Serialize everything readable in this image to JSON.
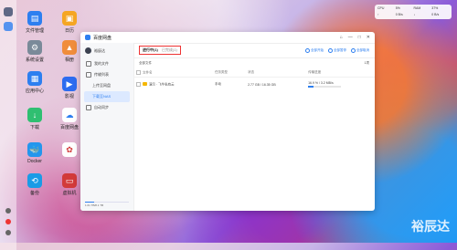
{
  "desktop": {
    "icons": [
      {
        "label": "文件管理",
        "color": "#2d7ff0",
        "icon": "folder-icon"
      },
      {
        "label": "系统设置",
        "color": "#7a8a99",
        "icon": "gear-icon"
      },
      {
        "label": "应用中心",
        "color": "#2d7ff0",
        "icon": "grid-icon"
      },
      {
        "label": "下载",
        "color": "#2fbf71",
        "icon": "download-icon"
      },
      {
        "label": "Docker",
        "color": "#2496ed",
        "icon": "docker-icon"
      },
      {
        "label": "备份",
        "color": "#1a9be6",
        "icon": "backup-icon"
      },
      {
        "label": "日历",
        "color": "#f5a623",
        "icon": "calendar-icon"
      },
      {
        "label": "相册",
        "color": "#f08d3c",
        "icon": "photo-icon"
      },
      {
        "label": "影视",
        "color": "#2d6cf0",
        "icon": "video-icon"
      },
      {
        "label": "百度网盘",
        "color": "#ffffff",
        "icon": "baidu-cloud-icon"
      },
      {
        "label": "",
        "color": "#ffffff",
        "icon": "app-icon"
      },
      {
        "label": "虚拟机",
        "color": "#d23a3a",
        "icon": "vm-icon"
      }
    ],
    "watermark": "裕辰达",
    "status": {
      "cells": [
        "CPU",
        "5%",
        "RAM",
        "37%",
        "↑",
        "0 B/s",
        "↓",
        "0 B/s"
      ]
    }
  },
  "window": {
    "title": "百度网盘",
    "controls": [
      "⌂",
      "—",
      "□",
      "✕"
    ]
  },
  "sidebar": {
    "username": "裕辰达",
    "items": [
      {
        "label": "我的文件",
        "sub": false,
        "active": false
      },
      {
        "label": "传输列表",
        "sub": false,
        "active": false
      },
      {
        "label": "上传至网盘",
        "sub": true,
        "active": false
      },
      {
        "label": "下载至NAS",
        "sub": true,
        "active": true
      },
      {
        "label": "自动同步",
        "sub": false,
        "active": false
      }
    ],
    "quota_text": "1.61 TB/8.1 TB"
  },
  "main": {
    "tabs": [
      {
        "label": "进行中(1)",
        "active": true
      },
      {
        "label": "已完成(1)",
        "active": false
      }
    ],
    "actions": [
      "全部开始",
      "全部暂停",
      "全部取消"
    ],
    "subheader": {
      "label": "全部文件",
      "count": "1项"
    },
    "columns": [
      "文件名",
      "任务类型",
      "状态",
      "传输进度"
    ],
    "rows": [
      {
        "name": "演示 · 飞牛私有云",
        "type": "手动",
        "status": "2.77 GB / 16.35 GB",
        "progress_text": "16.9 %  /  3.2 MB/s",
        "progress": 0.17
      }
    ]
  }
}
